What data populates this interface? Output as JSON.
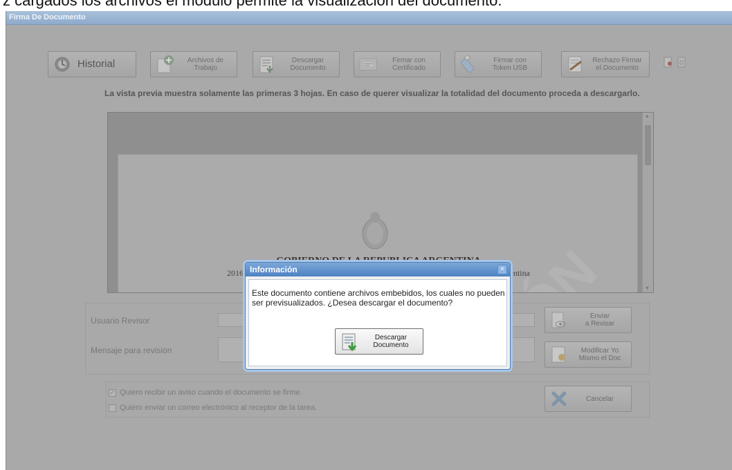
{
  "caption": "z cargados los archivos el módulo permite la visualización del documento.",
  "window": {
    "title": "Firma De Documento"
  },
  "toolbar": {
    "historial": "Historial",
    "archivos": "Archivos de\nTrabajo",
    "descargar": "Descargar\nDocumento",
    "firmar_cert": "Firmar con\nCertificado",
    "firmar_token": "Firmar con\nToken USB",
    "rechazo": "Rechazo Firmar\nel Documento"
  },
  "notice": "La vista previa muestra solamente las primeras 3 hojas. En caso de querer visualizar la totalidad del documento proceda a descargarlo.",
  "preview": {
    "gov_title": "GOBIERNO DE LA REPUBLICA ARGENTINA",
    "gov_subtitle": "2016 - Año del Bicentenario de la Declaración de Independencia de la República Argentina",
    "watermark": "ÓN"
  },
  "form": {
    "usuario_label": "Usuario Revisor",
    "mensaje_label": "Mensaje para revisión",
    "enviar": "Enviar\na Revisar",
    "modificar": "Modificar Yo\nMismo el Doc",
    "cancelar": "Cancelar",
    "chk_aviso": "Quiero recibir un aviso cuando el documento se firme.",
    "chk_correo": "Quiero enviar un correo electrónico al receptor de la tarea."
  },
  "modal": {
    "title": "Información",
    "message": "Este documento contiene archivos embebidos, los cuales no pueden ser previsualizados. ¿Desea descargar el documento?",
    "button": "Descargar\nDocumento"
  }
}
